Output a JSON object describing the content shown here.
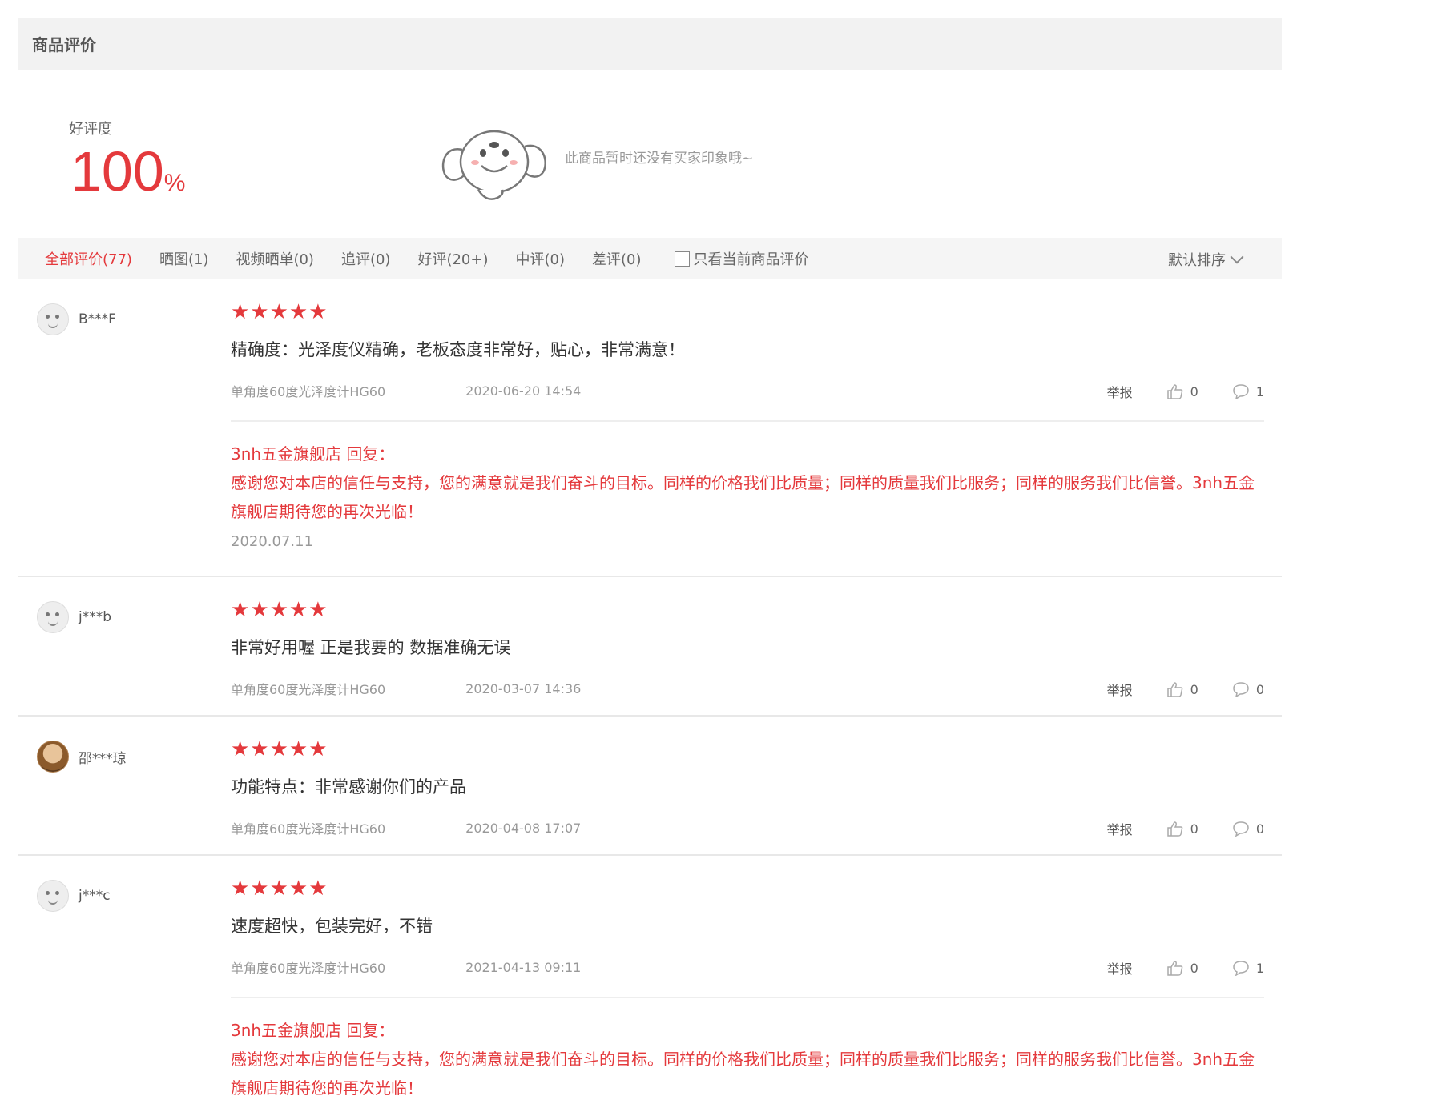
{
  "header": {
    "title": "商品评价"
  },
  "summary": {
    "rate_label": "好评度",
    "rate_value": "100",
    "rate_unit": "%",
    "no_impression": "此商品暂时还没有买家印象哦~"
  },
  "filters": {
    "tabs": [
      {
        "label": "全部评价(77)"
      },
      {
        "label": "晒图(1)"
      },
      {
        "label": "视频晒单(0)"
      },
      {
        "label": "追评(0)"
      },
      {
        "label": "好评(20+)"
      },
      {
        "label": "中评(0)"
      },
      {
        "label": "差评(0)"
      }
    ],
    "only_current": "只看当前商品评价",
    "sort": "默认排序"
  },
  "reviews": [
    {
      "user": "B***F",
      "stars": "★★★★★",
      "content": "精确度：光泽度仪精确，老板态度非常好，贴心，非常满意！",
      "product": "单角度60度光泽度计HG60",
      "date": "2020-06-20 14:54",
      "report": "举报",
      "likes": "0",
      "comments": "1",
      "reply": {
        "from": "3nh五金旗舰店 回复：",
        "text": "感谢您对本店的信任与支持，您的满意就是我们奋斗的目标。同样的价格我们比质量；同样的质量我们比服务；同样的服务我们比信誉。3nh五金旗舰店期待您的再次光临！",
        "date": "2020.07.11"
      }
    },
    {
      "user": "j***b",
      "stars": "★★★★★",
      "content": "非常好用喔 正是我要的 数据准确无误",
      "product": "单角度60度光泽度计HG60",
      "date": "2020-03-07 14:36",
      "report": "举报",
      "likes": "0",
      "comments": "0"
    },
    {
      "user": "邵***琼",
      "stars": "★★★★★",
      "content": "功能特点：非常感谢你们的产品",
      "product": "单角度60度光泽度计HG60",
      "date": "2020-04-08 17:07",
      "report": "举报",
      "likes": "0",
      "comments": "0"
    },
    {
      "user": "j***c",
      "stars": "★★★★★",
      "content": "速度超快，包装完好，不错",
      "product": "单角度60度光泽度计HG60",
      "date": "2021-04-13 09:11",
      "report": "举报",
      "likes": "0",
      "comments": "1",
      "reply": {
        "from": "3nh五金旗舰店 回复：",
        "text": "感谢您对本店的信任与支持，您的满意就是我们奋斗的目标。同样的价格我们比质量；同样的质量我们比服务；同样的服务我们比信誉。3nh五金旗舰店期待您的再次光临！"
      }
    }
  ]
}
